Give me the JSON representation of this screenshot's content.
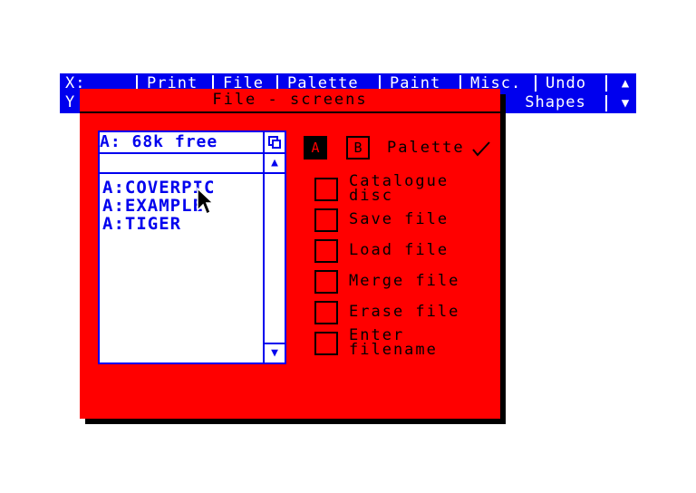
{
  "menubar": {
    "coord_x": "X: _",
    "coord_y": "Y",
    "items": [
      "Print",
      "File",
      "Palette",
      "Paint",
      "Misc.",
      "Undo"
    ],
    "shapes": "Shapes",
    "scroll_up": "▲",
    "scroll_down": "▼"
  },
  "dialog": {
    "title": "File - screens",
    "drive_info": "A: 68k free",
    "files": [
      "A:COVERPIC",
      "A:EXAMPLE",
      "A:TIGER"
    ],
    "drive_buttons": [
      "A",
      "B"
    ],
    "palette_label": "Palette",
    "options": [
      {
        "line1": "Catalogue",
        "line2": "disc"
      },
      {
        "line1": "Save file",
        "line2": ""
      },
      {
        "line1": "Load file",
        "line2": ""
      },
      {
        "line1": "Merge file",
        "line2": ""
      },
      {
        "line1": "Erase file",
        "line2": ""
      },
      {
        "line1": "Enter",
        "line2": "filename"
      }
    ]
  },
  "colors": {
    "blue": "#0000ee",
    "red": "#ff0000",
    "black": "#000000",
    "white": "#ffffff"
  }
}
